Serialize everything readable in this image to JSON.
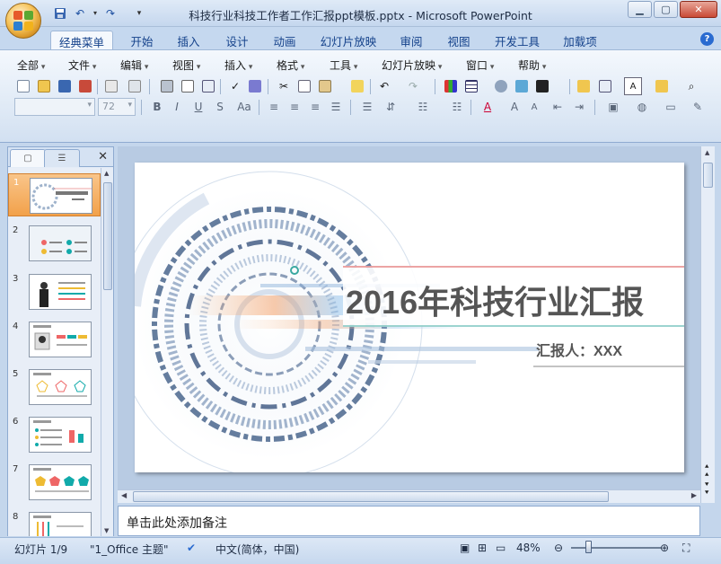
{
  "window": {
    "title": "科技行业科技工作者工作汇报ppt模板.pptx - Microsoft PowerPoint",
    "controls": [
      "minimize",
      "maximize",
      "close"
    ]
  },
  "quick_access": [
    "save-icon",
    "undo-icon",
    "redo-icon",
    "customize-icon"
  ],
  "ribbon_tabs": [
    "经典菜单",
    "开始",
    "插入",
    "设计",
    "动画",
    "幻灯片放映",
    "审阅",
    "视图",
    "开发工具",
    "加载项"
  ],
  "active_tab": "经典菜单",
  "classic_menu": [
    "全部",
    "文件",
    "编辑",
    "视图",
    "插入",
    "格式",
    "工具",
    "幻灯片放映",
    "窗口",
    "帮助"
  ],
  "font": {
    "name_value": "",
    "size_value": "72"
  },
  "format_buttons": [
    "B",
    "I",
    "U",
    "S",
    "Aa"
  ],
  "slides_pane": {
    "tabs": [
      "slides-tab",
      "outline-tab"
    ],
    "selected": 1,
    "thumbnails": [
      {
        "num": "1"
      },
      {
        "num": "2"
      },
      {
        "num": "3"
      },
      {
        "num": "4"
      },
      {
        "num": "5"
      },
      {
        "num": "6"
      },
      {
        "num": "7"
      },
      {
        "num": "8"
      }
    ]
  },
  "slide": {
    "title": "2016年科技行业汇报",
    "subtitle": "汇报人：XXX"
  },
  "notes": {
    "placeholder": "单击此处添加备注"
  },
  "status": {
    "slide_info": "幻灯片 1/9",
    "theme": "\"1_Office 主题\"",
    "language": "中文(简体，中国)",
    "zoom": "48%"
  },
  "colors": {
    "accent": "#f2a14a",
    "title_text": "#555555",
    "teal_line": "#3aa8a0",
    "red_line": "#d94a4a"
  }
}
